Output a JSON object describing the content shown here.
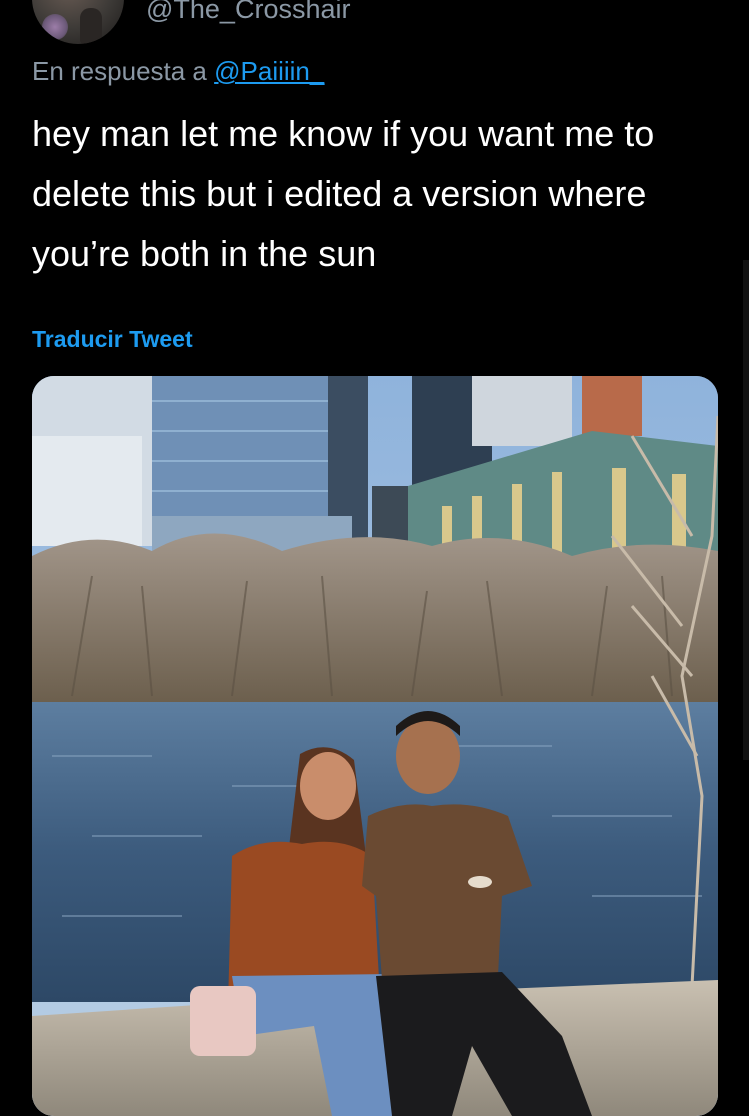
{
  "tweet": {
    "handle": "@The_Crosshair",
    "reply_prefix": "En respuesta a ",
    "reply_mention": "@Paiiiin_",
    "text": "hey man let me know if you want me to delete this but i edited a version where you’re both in the sun",
    "translate_label": "Traducir Tweet",
    "avatar_icon": "user-avatar",
    "media": "photo-couple-by-lake"
  },
  "colors": {
    "background": "#000000",
    "text": "#ffffff",
    "secondary": "#8b98a5",
    "link": "#1d9bf0"
  }
}
